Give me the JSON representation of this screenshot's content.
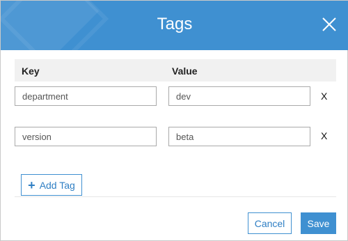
{
  "dialog": {
    "title": "Tags",
    "header_color": "#3f90d1"
  },
  "table": {
    "headers": {
      "key": "Key",
      "value": "Value"
    },
    "rows": [
      {
        "key": "department",
        "value": "dev",
        "remove_label": "X"
      },
      {
        "key": "version",
        "value": "beta",
        "remove_label": "X"
      }
    ]
  },
  "actions": {
    "add_icon": "plus-icon",
    "add_label": "Add Tag",
    "cancel_label": "Cancel",
    "save_label": "Save",
    "close_icon": "close-icon"
  }
}
